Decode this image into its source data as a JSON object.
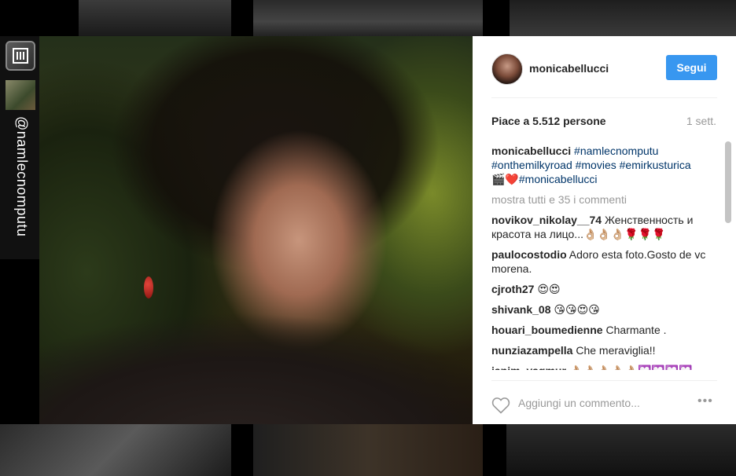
{
  "post": {
    "username": "monicabellucci",
    "follow_label": "Segui",
    "likes_text": "Piace a 5.512 persone",
    "time": "1 sett.",
    "caption": {
      "user": "monicabellucci",
      "line1_tag1": "#namlecnomputu",
      "line2_tags": "#onthemilkyroad #movies #emirkusturica",
      "line3_emoji": "🎬❤️",
      "line3_tag": "#monicabellucci"
    },
    "show_all_comments": "mostra tutti e 35 i commenti",
    "comments": [
      {
        "user": "novikov_nikolay__74",
        "text": "Женственность и красота на лицо...👌🏼👌🏼👌🏼🌹🌹🌹"
      },
      {
        "user": "paulocostodio",
        "text": "Adoro esta foto.Gosto de vc morena."
      },
      {
        "user": "cjroth27",
        "text": "😍😍"
      },
      {
        "user": "shivank_08",
        "text": "😘😘😍😘"
      },
      {
        "user": "houari_boumedienne",
        "text": "Charmante ."
      },
      {
        "user": "nunziazampella",
        "text": "Che meraviglia!!"
      },
      {
        "user": "ianim_yagmur",
        "text": "👌🏼👌🏼👌🏼👌🏼👌🏼💟💟💟💟"
      }
    ],
    "comment_placeholder": "Aggiungi un commento...",
    "more_options": "•••"
  },
  "repost_strip": {
    "handle": "@namlecnomputu"
  }
}
